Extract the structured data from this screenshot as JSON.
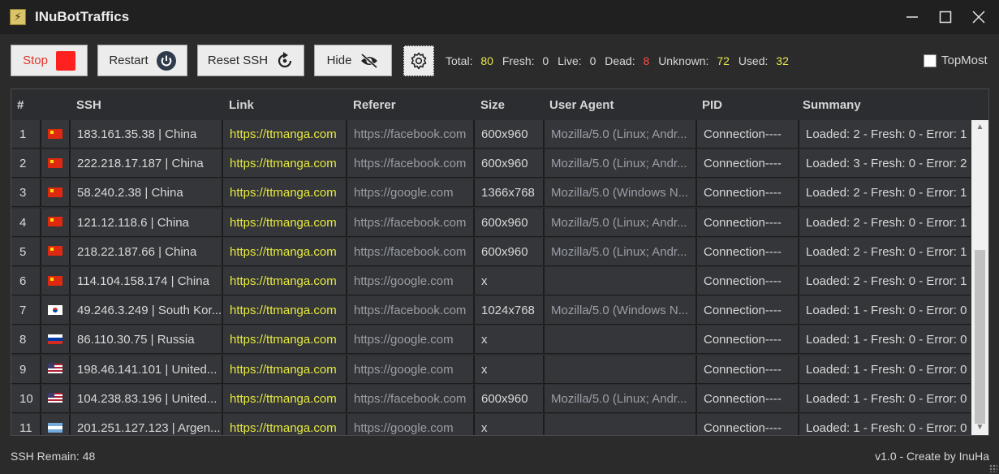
{
  "window": {
    "title": "INuBotTraffics",
    "controls": [
      "minimize",
      "maximize",
      "close"
    ]
  },
  "toolbar": {
    "stop_label": "Stop",
    "restart_label": "Restart",
    "reset_ssh_label": "Reset SSH",
    "hide_label": "Hide",
    "topmost_label": "TopMost",
    "topmost_checked": false
  },
  "stats": {
    "total_label": "Total:",
    "total": "80",
    "fresh_label": "Fresh:",
    "fresh": "0",
    "live_label": "Live:",
    "live": "0",
    "dead_label": "Dead:",
    "dead": "8",
    "unknown_label": "Unknown:",
    "unknown": "72",
    "used_label": "Used:",
    "used": "32"
  },
  "table": {
    "columns": [
      "#",
      "SSH",
      "Link",
      "Referer",
      "Size",
      "User Agent",
      "PID",
      "Summany"
    ],
    "rows": [
      {
        "num": "1",
        "flag": "cn",
        "ssh": "183.161.35.38 | China",
        "link": "https://ttmanga.com",
        "referer": "https://facebook.com",
        "size": "600x960",
        "ua": "Mozilla/5.0 (Linux; Andr...",
        "pid": "Connection----",
        "summary": "Loaded: 2 - Fresh: 0 - Error: 1"
      },
      {
        "num": "2",
        "flag": "cn",
        "ssh": "222.218.17.187 | China",
        "link": "https://ttmanga.com",
        "referer": "https://facebook.com",
        "size": "600x960",
        "ua": "Mozilla/5.0 (Linux; Andr...",
        "pid": "Connection----",
        "summary": "Loaded: 3 - Fresh: 0 - Error: 2"
      },
      {
        "num": "3",
        "flag": "cn",
        "ssh": "58.240.2.38 | China",
        "link": "https://ttmanga.com",
        "referer": "https://google.com",
        "size": "1366x768",
        "ua": "Mozilla/5.0 (Windows N...",
        "pid": "Connection----",
        "summary": "Loaded: 2 - Fresh: 0 - Error: 1"
      },
      {
        "num": "4",
        "flag": "cn",
        "ssh": "121.12.118.6 | China",
        "link": "https://ttmanga.com",
        "referer": "https://facebook.com",
        "size": "600x960",
        "ua": "Mozilla/5.0 (Linux; Andr...",
        "pid": "Connection----",
        "summary": "Loaded: 2 - Fresh: 0 - Error: 1"
      },
      {
        "num": "5",
        "flag": "cn",
        "ssh": "218.22.187.66 | China",
        "link": "https://ttmanga.com",
        "referer": "https://facebook.com",
        "size": "600x960",
        "ua": "Mozilla/5.0 (Linux; Andr...",
        "pid": "Connection----",
        "summary": "Loaded: 2 - Fresh: 0 - Error: 1"
      },
      {
        "num": "6",
        "flag": "cn",
        "ssh": "114.104.158.174 | China",
        "link": "https://ttmanga.com",
        "referer": "https://google.com",
        "size": "x",
        "ua": "",
        "pid": "Connection----",
        "summary": "Loaded: 2 - Fresh: 0 - Error: 1"
      },
      {
        "num": "7",
        "flag": "kr",
        "ssh": "49.246.3.249 | South Kor...",
        "link": "https://ttmanga.com",
        "referer": "https://facebook.com",
        "size": "1024x768",
        "ua": "Mozilla/5.0 (Windows N...",
        "pid": "Connection----",
        "summary": "Loaded: 1 - Fresh: 0 - Error: 0"
      },
      {
        "num": "8",
        "flag": "ru",
        "ssh": "86.110.30.75 | Russia",
        "link": "https://ttmanga.com",
        "referer": "https://google.com",
        "size": "x",
        "ua": "",
        "pid": "Connection----",
        "summary": "Loaded: 1 - Fresh: 0 - Error: 0"
      },
      {
        "num": "9",
        "flag": "us",
        "ssh": "198.46.141.101 | United...",
        "link": "https://ttmanga.com",
        "referer": "https://google.com",
        "size": "x",
        "ua": "",
        "pid": "Connection----",
        "summary": "Loaded: 1 - Fresh: 0 - Error: 0"
      },
      {
        "num": "10",
        "flag": "us",
        "ssh": "104.238.83.196 | United...",
        "link": "https://ttmanga.com",
        "referer": "https://facebook.com",
        "size": "600x960",
        "ua": "Mozilla/5.0 (Linux; Andr...",
        "pid": "Connection----",
        "summary": "Loaded: 1 - Fresh: 0 - Error: 0"
      },
      {
        "num": "11",
        "flag": "ar",
        "ssh": "201.251.127.123 | Argen...",
        "link": "https://ttmanga.com",
        "referer": "https://google.com",
        "size": "x",
        "ua": "",
        "pid": "Connection----",
        "summary": "Loaded: 1 - Fresh: 0 - Error: 0"
      }
    ]
  },
  "status": {
    "remain": "SSH Remain: 48",
    "credit": "v1.0 - Create by InuHa"
  },
  "colors": {
    "accent_link": "#e8ea3c",
    "dead_value": "#ff4a4a",
    "stat_value": "#e7e84a",
    "stop": "#ff2020"
  }
}
